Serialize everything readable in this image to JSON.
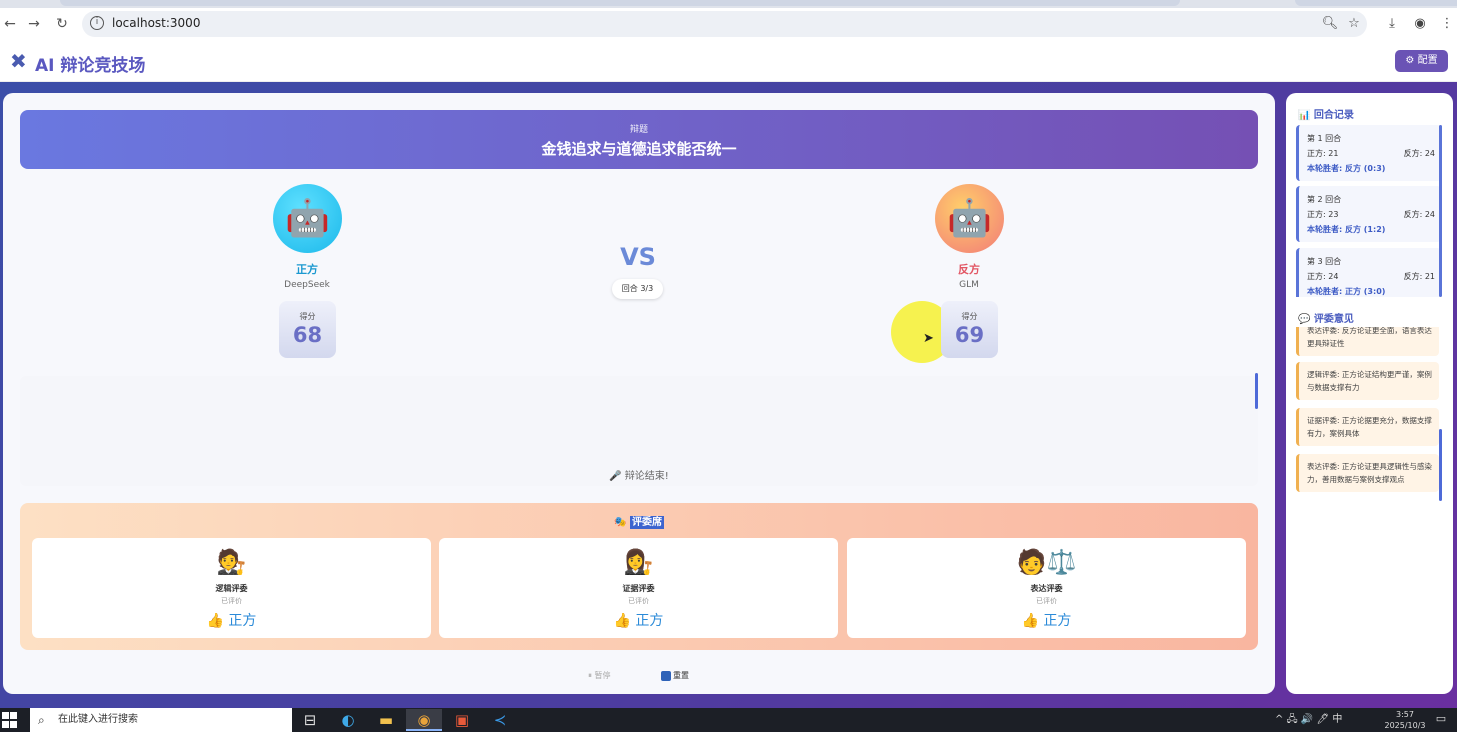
{
  "browser": {
    "url": "localhost:3000",
    "nav_icons": [
      "back-arrow-icon",
      "forward-arrow-icon",
      "reload-icon"
    ],
    "toolbar_icons": [
      "zoom-icon",
      "star-icon",
      "download-icon",
      "profile-icon",
      "menu-icon"
    ]
  },
  "app": {
    "title": "AI 辩论竞技场",
    "config_label": "⚙ 配置"
  },
  "topic": {
    "label": "辩题",
    "text": "金钱追求与道德追求能否统一"
  },
  "pro": {
    "emoji": "🤖",
    "label": "正方",
    "model": "DeepSeek",
    "score_label": "得分",
    "score": "68"
  },
  "con": {
    "emoji": "🤖",
    "label": "反方",
    "model": "GLM",
    "score_label": "得分",
    "score": "69"
  },
  "vs_text": "VS",
  "round_status": "回合 3/3",
  "speech": {
    "end_text": "🎤 辩论结束!"
  },
  "judges": {
    "title_icon": "🎭",
    "title": "评委席",
    "items": [
      {
        "emoji": "🧑‍⚖️",
        "name": "逻辑评委",
        "status": "已评价",
        "vote": "👍 正方"
      },
      {
        "emoji": "👩‍⚖️",
        "name": "证据评委",
        "status": "已评价",
        "vote": "👍 正方"
      },
      {
        "emoji": "🧑⚖️",
        "name": "表达评委",
        "status": "已评价",
        "vote": "👍 正方"
      }
    ]
  },
  "controls": {
    "pause": "⏸ 暂停",
    "reset": "重置"
  },
  "sidebar": {
    "rounds_title": "📊 回合记录",
    "rounds": [
      {
        "title": "第 1 回合",
        "pro": "正方: 21",
        "con": "反方: 24",
        "winner": "本轮胜者: 反方 (0:3)"
      },
      {
        "title": "第 2 回合",
        "pro": "正方: 23",
        "con": "反方: 24",
        "winner": "本轮胜者: 反方 (1:2)"
      },
      {
        "title": "第 3 回合",
        "pro": "正方: 24",
        "con": "反方: 21",
        "winner": "本轮胜者: 正方 (3:0)"
      }
    ],
    "opinions_title": "💬 评委意见",
    "opinions": [
      "表达评委: 反方论证更全面，语言表达更具辩证性",
      "逻辑评委: 正方论证结构更严谨，案例与数据支撑有力",
      "证据评委: 正方论据更充分，数据支撑有力，案例具体",
      "表达评委: 正方论证更具逻辑性与感染力，善用数据与案例支撑观点"
    ]
  },
  "taskbar": {
    "search_placeholder": "在此键入进行搜索",
    "tray": "^ 🖧 🔊 🖊 中",
    "time": "3:57",
    "date": "2025/10/3"
  }
}
